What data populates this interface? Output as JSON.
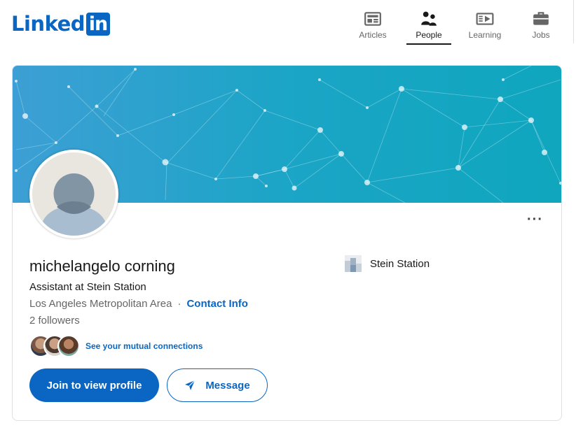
{
  "brand": {
    "wordmark": "Linked",
    "mark": "in",
    "color": "#0a66c2"
  },
  "nav": [
    {
      "label": "Articles",
      "icon": "articles-icon",
      "active": false
    },
    {
      "label": "People",
      "icon": "people-icon",
      "active": true
    },
    {
      "label": "Learning",
      "icon": "learning-icon",
      "active": false
    },
    {
      "label": "Jobs",
      "icon": "jobs-icon",
      "active": false
    }
  ],
  "profile": {
    "name": "michelangelo corning",
    "headline": "Assistant at Stein Station",
    "location": "Los Angeles Metropolitan Area",
    "separator": "·",
    "contact_label": "Contact Info",
    "followers": "2 followers",
    "mutual_label": "See your mutual connections",
    "more_label": "···"
  },
  "company": {
    "name": "Stein Station"
  },
  "actions": {
    "join_label": "Join to view profile",
    "message_label": "Message"
  }
}
